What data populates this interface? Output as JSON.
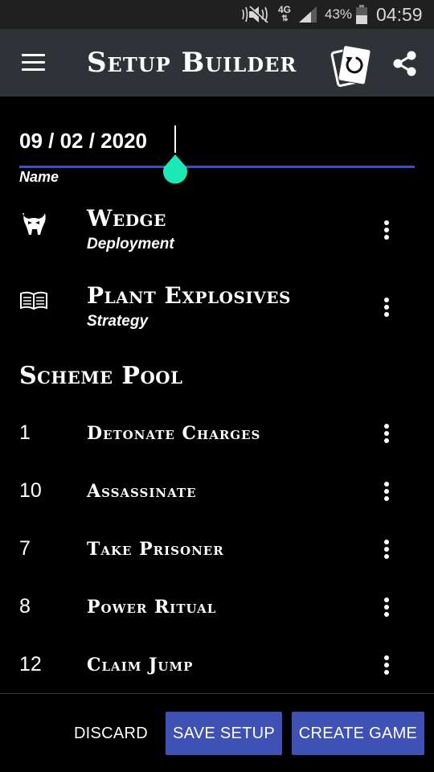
{
  "status_bar": {
    "network": "4G",
    "battery": "43%",
    "time": "04:59",
    "icons": [
      "mute-icon",
      "network-arrows-icon",
      "signal-icon",
      "battery-icon"
    ]
  },
  "app_bar": {
    "title": "Setup Builder",
    "icons": [
      "menu-icon",
      "card-refresh-icon",
      "share-icon"
    ]
  },
  "name_field": {
    "value": "09 / 02 / 2020",
    "label": "Name"
  },
  "deployment": {
    "title": "Wedge",
    "subtitle": "Deployment",
    "icon": "mask-icon"
  },
  "strategy": {
    "title": "Plant Explosives",
    "subtitle": "Strategy",
    "icon": "book-icon"
  },
  "scheme_pool": {
    "heading": "Scheme Pool",
    "items": [
      {
        "number": "1",
        "name": "Detonate Charges"
      },
      {
        "number": "10",
        "name": "Assassinate"
      },
      {
        "number": "7",
        "name": "Take Prisoner"
      },
      {
        "number": "8",
        "name": "Power Ritual"
      },
      {
        "number": "12",
        "name": "Claim Jump"
      }
    ]
  },
  "actions": {
    "discard": "DISCARD",
    "save": "SAVE SETUP",
    "create": "CREATE GAME"
  },
  "colors": {
    "accent": "#3f51b5",
    "handle": "#1de9b6",
    "app_bar": "#2f3337",
    "status_bar": "#202020",
    "background": "#000000"
  }
}
